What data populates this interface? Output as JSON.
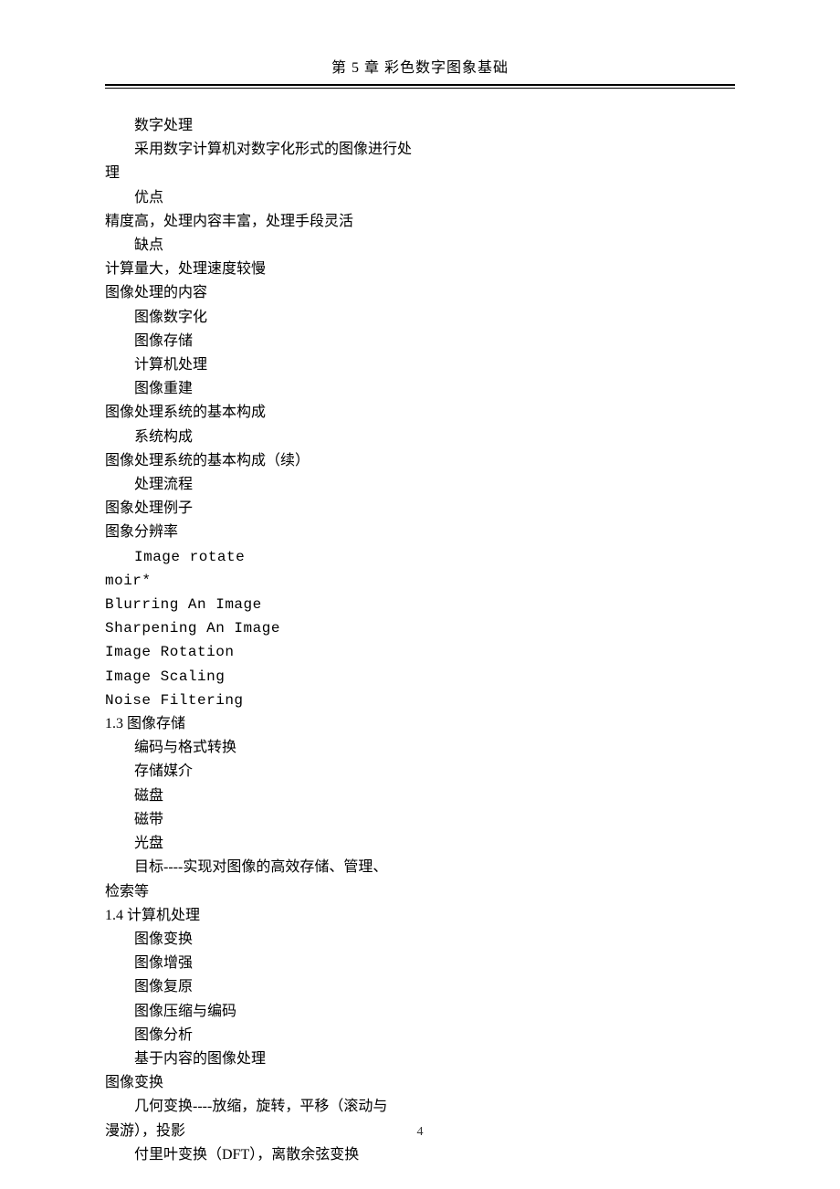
{
  "header": "第 5 章  彩色数字图象基础",
  "page_number": "4",
  "lines": [
    {
      "text": "数字处理",
      "indent": true,
      "mono": false
    },
    {
      "text": "采用数字计算机对数字化形式的图像进行处",
      "indent": true,
      "mono": false
    },
    {
      "text": "理",
      "indent": false,
      "mono": false
    },
    {
      "text": "优点",
      "indent": true,
      "mono": false
    },
    {
      "text": "精度高，处理内容丰富，处理手段灵活",
      "indent": false,
      "mono": false
    },
    {
      "text": "缺点",
      "indent": true,
      "mono": false
    },
    {
      "text": "计算量大，处理速度较慢",
      "indent": false,
      "mono": false
    },
    {
      "text": "图像处理的内容",
      "indent": false,
      "mono": false
    },
    {
      "text": "图像数字化",
      "indent": true,
      "mono": false
    },
    {
      "text": "图像存储",
      "indent": true,
      "mono": false
    },
    {
      "text": "计算机处理",
      "indent": true,
      "mono": false
    },
    {
      "text": "图像重建",
      "indent": true,
      "mono": false
    },
    {
      "text": "图像处理系统的基本构成",
      "indent": false,
      "mono": false
    },
    {
      "text": "系统构成",
      "indent": true,
      "mono": false
    },
    {
      "text": "图像处理系统的基本构成（续）",
      "indent": false,
      "mono": false
    },
    {
      "text": "处理流程",
      "indent": true,
      "mono": false
    },
    {
      "text": "图象处理例子",
      "indent": false,
      "mono": false
    },
    {
      "text": "图象分辨率",
      "indent": false,
      "mono": false
    },
    {
      "text": "Image rotate",
      "indent": true,
      "mono": true
    },
    {
      "text": "moir*",
      "indent": false,
      "mono": true
    },
    {
      "text": "Blurring An Image",
      "indent": false,
      "mono": true
    },
    {
      "text": "Sharpening An Image",
      "indent": false,
      "mono": true
    },
    {
      "text": "Image Rotation",
      "indent": false,
      "mono": true
    },
    {
      "text": "Image Scaling",
      "indent": false,
      "mono": true
    },
    {
      "text": "Noise Filtering",
      "indent": false,
      "mono": true
    },
    {
      "text": "1.3 图像存储",
      "indent": false,
      "mono": false
    },
    {
      "text": "编码与格式转换",
      "indent": true,
      "mono": false
    },
    {
      "text": "存储媒介",
      "indent": true,
      "mono": false
    },
    {
      "text": "磁盘",
      "indent": true,
      "mono": false
    },
    {
      "text": "磁带",
      "indent": true,
      "mono": false
    },
    {
      "text": "光盘",
      "indent": true,
      "mono": false
    },
    {
      "text": "目标----实现对图像的高效存储、管理、",
      "indent": true,
      "mono": false
    },
    {
      "text": "检索等",
      "indent": false,
      "mono": false
    },
    {
      "text": "1.4 计算机处理",
      "indent": false,
      "mono": false
    },
    {
      "text": "图像变换",
      "indent": true,
      "mono": false
    },
    {
      "text": "图像增强",
      "indent": true,
      "mono": false
    },
    {
      "text": "图像复原",
      "indent": true,
      "mono": false
    },
    {
      "text": "图像压缩与编码",
      "indent": true,
      "mono": false
    },
    {
      "text": "图像分析",
      "indent": true,
      "mono": false
    },
    {
      "text": "基于内容的图像处理",
      "indent": true,
      "mono": false
    },
    {
      "text": "图像变换",
      "indent": false,
      "mono": false
    },
    {
      "text": "几何变换----放缩，旋转，平移（滚动与",
      "indent": true,
      "mono": false
    },
    {
      "text": "漫游），投影",
      "indent": false,
      "mono": false
    },
    {
      "text": "付里叶变换（DFT），离散余弦变换",
      "indent": true,
      "mono": false
    }
  ]
}
